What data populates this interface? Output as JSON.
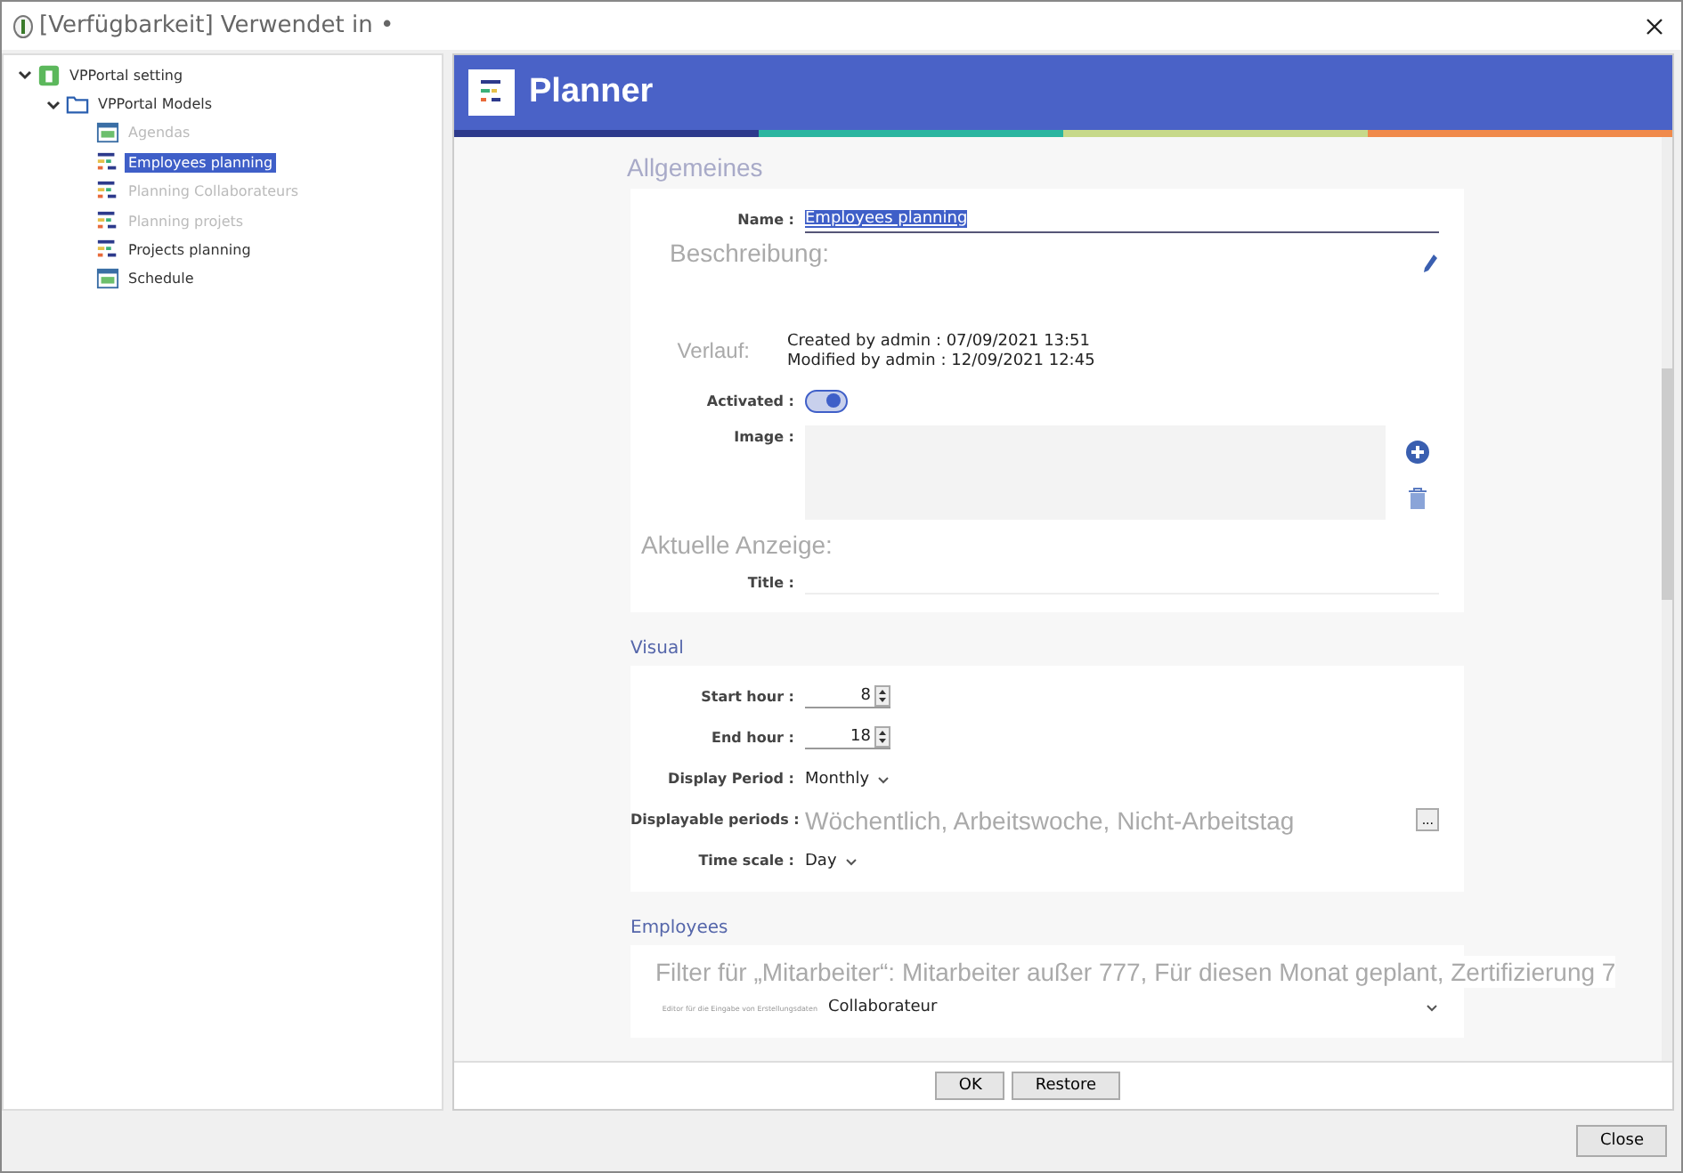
{
  "window": {
    "title": "[Verfügbarkeit] Verwendet in •"
  },
  "tree": [
    {
      "label": "VPPortal setting",
      "kind": "root",
      "expanded": true,
      "selected": false,
      "disabled": false,
      "children": [
        {
          "label": "VPPortal Models",
          "kind": "folder",
          "expanded": true,
          "selected": false,
          "disabled": false,
          "children": [
            {
              "label": "Agendas",
              "kind": "calendar",
              "selected": false,
              "disabled": true
            },
            {
              "label": "Employees planning",
              "kind": "planner",
              "selected": true,
              "disabled": false
            },
            {
              "label": "Planning Collaborateurs",
              "kind": "planner",
              "selected": false,
              "disabled": true
            },
            {
              "label": "Planning projets",
              "kind": "planner",
              "selected": false,
              "disabled": true
            },
            {
              "label": "Projects planning",
              "kind": "planner",
              "selected": false,
              "disabled": false
            },
            {
              "label": "Schedule",
              "kind": "calendar",
              "selected": false,
              "disabled": false
            }
          ]
        }
      ]
    }
  ],
  "header": {
    "title": "Planner"
  },
  "general": {
    "heading": "Allgemeines",
    "name_label": "Name :",
    "name_value": "Employees planning",
    "description_label": "Beschreibung:",
    "history_label": "Verlauf:",
    "created": "Created by admin : 07/09/2021 13:51",
    "modified": "Modified by admin : 12/09/2021 12:45",
    "activated_label": "Activated :",
    "activated": true,
    "image_label": "Image :",
    "current_label": "Aktuelle Anzeige:",
    "title_label": "Title :"
  },
  "visual": {
    "heading": "Visual",
    "start_label": "Start hour :",
    "start_value": "8",
    "end_label": "End hour :",
    "end_value": "18",
    "period_label": "Display Period :",
    "period_value": "Monthly",
    "periods_label": "Displayable periods :",
    "periods_value": "Wöchentlich, Arbeitswoche, Nicht-Arbeitstag",
    "periods_button": "...",
    "scale_label": "Time scale :",
    "scale_value": "Day"
  },
  "employees": {
    "heading": "Employees",
    "filter": "Filter für „Mitarbeiter“: Mitarbeiter außer 777, Für diesen Monat geplant, Zertifizierung 7",
    "editor_label": "Editor für die Eingabe von Erstellungsdaten",
    "editor_value": "Collaborateur"
  },
  "buttons": [
    "OK",
    "Restore"
  ],
  "footer_button": "Close"
}
